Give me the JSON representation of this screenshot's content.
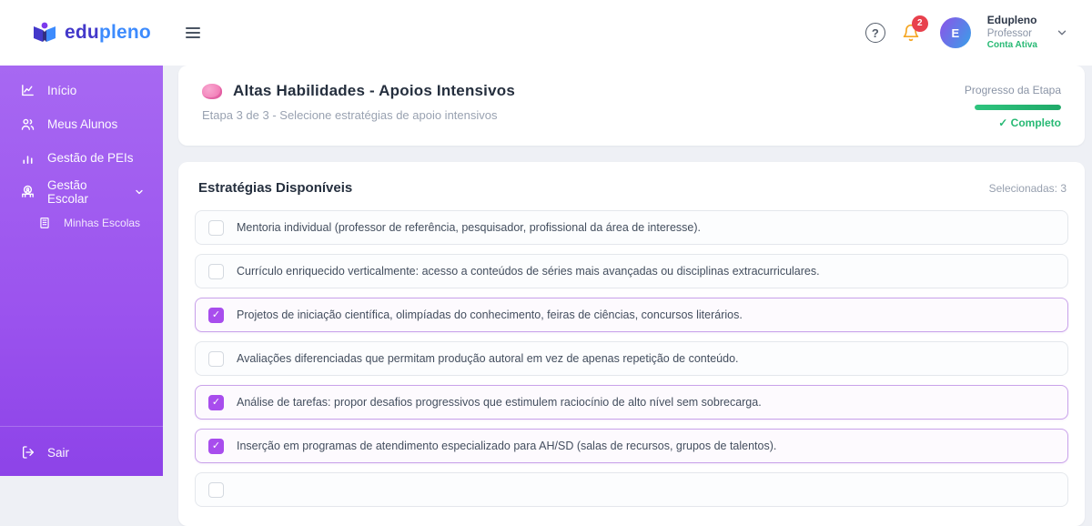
{
  "header": {
    "logo": {
      "edu": "edu",
      "pleno": "pleno"
    },
    "notifications": {
      "count": "2"
    },
    "user": {
      "name": "Edupleno",
      "role": "Professor",
      "status": "Conta Ativa",
      "avatar_initial": "E"
    }
  },
  "sidebar": {
    "items": [
      {
        "label": "Início",
        "icon": "line-chart-icon"
      },
      {
        "label": "Meus Alunos",
        "icon": "users-icon"
      },
      {
        "label": "Gestão de PEIs",
        "icon": "bar-chart-icon"
      },
      {
        "label": "Gestão Escolar",
        "icon": "school-icon",
        "has_chevron": true
      },
      {
        "label": "Minhas Escolas",
        "icon": "building-icon",
        "sub_item": true
      }
    ],
    "logout_label": "Sair"
  },
  "step_card": {
    "icon": "brain-emoji",
    "title": "Altas Habilidades - Apoios Intensivos",
    "subtitle": "Etapa 3 de 3 - Selecione estratégias de apoio intensivos",
    "progress_label": "Progresso da Etapa",
    "progress_percent": 100,
    "status": "✓ Completo"
  },
  "strategies": {
    "title": "Estratégias Disponíveis",
    "selected_label": "Selecionadas: 3",
    "items": [
      {
        "label": "Mentoria individual (professor de referência, pesquisador, profissional da área de interesse).",
        "checked": false
      },
      {
        "label": "Currículo enriquecido verticalmente: acesso a conteúdos de séries mais avançadas ou disciplinas extracurriculares.",
        "checked": false
      },
      {
        "label": "Projetos de iniciação científica, olimpíadas do conhecimento, feiras de ciências, concursos literários.",
        "checked": true
      },
      {
        "label": "Avaliações diferenciadas que permitam produção autoral em vez de apenas repetição de conteúdo.",
        "checked": false
      },
      {
        "label": "Análise de tarefas: propor desafios progressivos que estimulem raciocínio de alto nível sem sobrecarga.",
        "checked": true
      },
      {
        "label": "Inserção em programas de atendimento especializado para AH/SD (salas de recursos, grupos de talentos).",
        "checked": true
      }
    ]
  },
  "colors": {
    "accent_purple": "#a84ded",
    "sidebar_purple": "#9b53ee",
    "success_green": "#27b974",
    "badge_red": "#e8414d",
    "bell_amber": "#f5a623",
    "logo_indigo": "#4338ca",
    "logo_blue": "#3d8bfd"
  }
}
